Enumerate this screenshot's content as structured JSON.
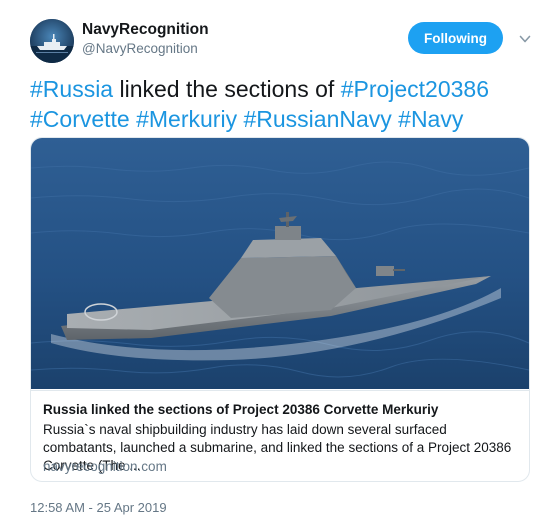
{
  "author": {
    "display_name": "NavyRecognition",
    "handle": "@NavyRecognition",
    "avatar_icon": "ship-logo-icon"
  },
  "follow_button": {
    "label": "Following"
  },
  "menu": {
    "icon": "chevron-down-icon"
  },
  "tweet": {
    "segments": [
      {
        "text": "#Russia",
        "hashtag": true
      },
      {
        "text": " linked the sections of ",
        "hashtag": false
      },
      {
        "text": "#Project20386",
        "hashtag": true
      },
      {
        "text": " ",
        "hashtag": false
      },
      {
        "text": "#Corvette",
        "hashtag": true
      },
      {
        "text": " ",
        "hashtag": false
      },
      {
        "text": "#Merkuriy",
        "hashtag": true
      },
      {
        "text": " ",
        "hashtag": false
      },
      {
        "text": "#RussianNavy",
        "hashtag": true
      },
      {
        "text": " ",
        "hashtag": false
      },
      {
        "text": "#Navy",
        "hashtag": true
      }
    ]
  },
  "card": {
    "title": "Russia linked the sections of Project 20386 Corvette Merkuriy",
    "description": "Russia`s naval shipbuilding industry has laid down several surfaced combatants, launched a submarine, and linked the sections of a Project 20386 Corvette (The ...",
    "domain": "navyrecognition.com"
  },
  "timestamp": "12:58 AM - 25 Apr 2019",
  "colors": {
    "accent": "#1da1f2",
    "hashtag": "#1b95e0",
    "secondary_text": "#657786"
  }
}
